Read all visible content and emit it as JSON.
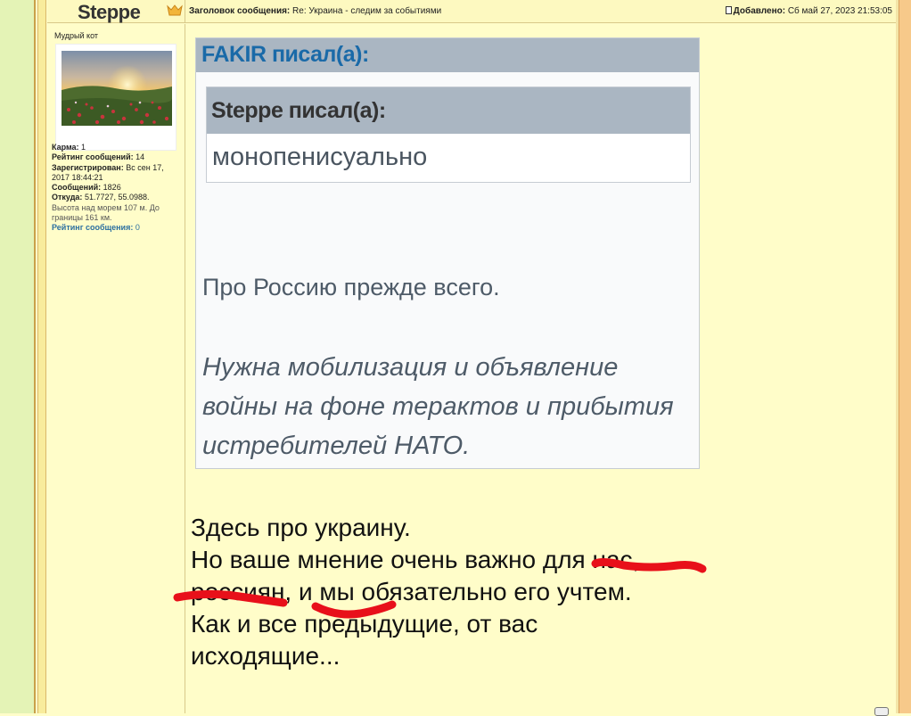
{
  "post": {
    "author": "Steppe",
    "subject_label": "Заголовок сообщения:",
    "subject": "Re: Украина - следим за событиями",
    "date_label": "Добавлено:",
    "date": "Сб май 27, 2023 21:53:05"
  },
  "profile": {
    "rank": "Мудрый кот",
    "karma_label": "Карма:",
    "karma": "1",
    "rating_label": "Рейтинг сообщений:",
    "rating": "14",
    "registered_label": "Зарегистрирован:",
    "registered": "Вс сен 17, 2017 18:44:21",
    "posts_label": "Сообщений:",
    "posts": "1826",
    "from_label": "Откуда:",
    "from": "51.7727, 55.0988.",
    "altitude": "Высота над морем 107 м. До границы 161 км.",
    "post_rating_label": "Рейтинг сообщения:",
    "post_rating": "0"
  },
  "quote_outer": {
    "header": "FAKIR писал(а):",
    "line1": "Про Россию прежде всего.",
    "italic_lines": [
      "Нужна мобилизация и объявление",
      "войны на фоне терактов и прибытия",
      "истребителей НАТО."
    ]
  },
  "quote_inner": {
    "header": "Steppe писал(а):",
    "text": "монопенисуально"
  },
  "reply": {
    "lines": [
      "Здесь про украину.",
      "Но ваше мнение очень важно для нас,",
      "россиян, и мы обязательно его учтем.",
      "Как и все предыдущие, от вас",
      "исходящие..."
    ]
  },
  "colors": {
    "page_bg": "#fffdc9",
    "quote_header_bg": "#aab6c2",
    "quote_author": "#1a6aa8",
    "annotation_marks": "#e8101a"
  }
}
